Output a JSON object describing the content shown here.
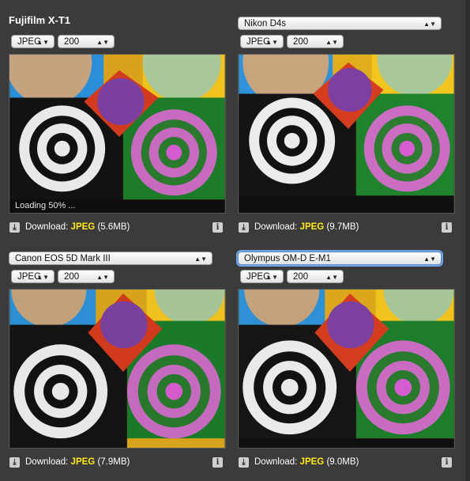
{
  "panels": [
    {
      "camera": "Fujifilm X-T1",
      "format": "JPEG",
      "iso": "200",
      "loading": "Loading 50% ...",
      "download_label": "Download:",
      "download_format": "JPEG",
      "download_size": "(5.6MB)"
    },
    {
      "camera": "Nikon D4s",
      "format": "JPEG",
      "iso": "200",
      "download_label": "Download:",
      "download_format": "JPEG",
      "download_size": "(9.7MB)"
    },
    {
      "camera": "Canon EOS 5D Mark III",
      "format": "JPEG",
      "iso": "200",
      "download_label": "Download:",
      "download_format": "JPEG",
      "download_size": "(7.9MB)"
    },
    {
      "camera": "Olympus OM-D E-M1",
      "format": "JPEG",
      "iso": "200",
      "download_label": "Download:",
      "download_format": "JPEG",
      "download_size": "(9.0MB)"
    }
  ],
  "icons": {
    "download": "download-icon",
    "info": "info-icon",
    "dropdown": "chevron-updown-icon"
  },
  "colors": {
    "background": "#3b3b3b",
    "format_link": "#ffe81a",
    "focus_ring": "#6fa6e8"
  }
}
